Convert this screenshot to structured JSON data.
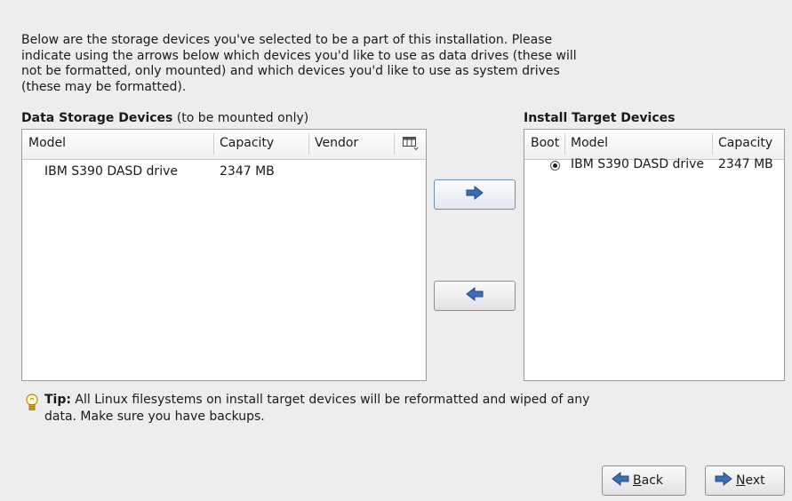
{
  "intro_lines": [
    "Below are the storage devices you've selected to be a part of this installation.  Please",
    "indicate using the arrows below which devices you'd like to use as data drives (these will",
    "not be formatted, only mounted) and which devices you'd like to use as system drives",
    "(these may be formatted)."
  ],
  "data_storage": {
    "title_bold": "Data Storage Devices",
    "title_rest": " (to be mounted only)",
    "columns": {
      "model": "Model",
      "capacity": "Capacity",
      "vendor": "Vendor"
    },
    "rows": [
      {
        "model": "IBM S390 DASD drive",
        "capacity": "2347 MB",
        "vendor": ""
      }
    ]
  },
  "install_target": {
    "title": "Install Target Devices",
    "columns": {
      "boot": "Boot",
      "model": "Model",
      "capacity": "Capacity"
    },
    "rows": [
      {
        "boot_selected": true,
        "model": "IBM S390 DASD drive",
        "capacity": "2347 MB"
      }
    ]
  },
  "tip": {
    "label": "Tip:",
    "line1": " All Linux filesystems on install target devices will be reformatted and wiped of any",
    "line2": "data.  Make sure you have backups."
  },
  "buttons": {
    "back_mnemonic": "B",
    "back_rest": "ack",
    "next_mnemonic": "N",
    "next_rest": "ext"
  },
  "icons": {
    "move_right": "arrow-right-icon",
    "move_left": "arrow-left-icon",
    "column_chooser": "column-chooser-icon",
    "tip": "lightbulb-icon"
  },
  "colors": {
    "arrow_blue": "#3a6db5",
    "background": "#ededed"
  }
}
